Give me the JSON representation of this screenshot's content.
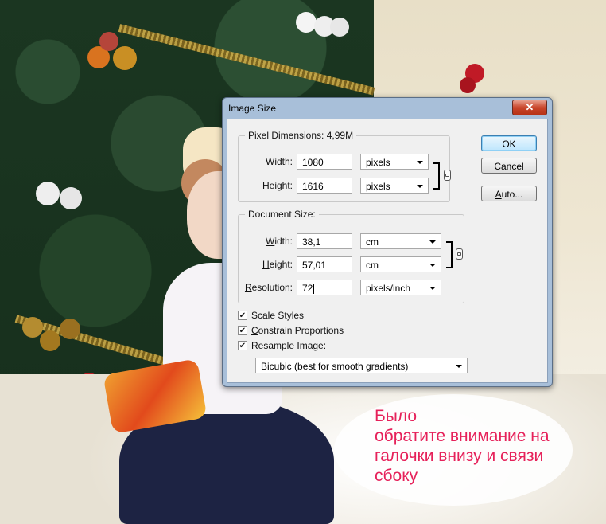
{
  "dialog": {
    "title": "Image Size",
    "close_glyph": "✕",
    "pixel_dimensions": {
      "title": "Pixel Dimensions:",
      "size": "4,99M",
      "width_label_u": "W",
      "width_label_rest": "idth:",
      "width_value": "1080",
      "width_unit": "pixels",
      "height_label_u": "H",
      "height_label_rest": "eight:",
      "height_value": "1616",
      "height_unit": "pixels"
    },
    "document_size": {
      "title": "Document Size:",
      "width_label_u": "W",
      "width_label_rest": "idth:",
      "width_value": "38,1",
      "width_unit": "cm",
      "height_label_u": "H",
      "height_label_rest": "eight:",
      "height_value": "57,01",
      "height_unit": "cm",
      "resolution_label_u": "R",
      "resolution_label_rest": "esolution:",
      "resolution_value": "72",
      "resolution_unit": "pixels/inch"
    },
    "options": {
      "scale_styles": "Scale Styles",
      "constrain_u": "C",
      "constrain_rest": "onstrain Proportions",
      "resample_u": "",
      "resample_rest": "Resample Image:",
      "resample_method": "Bicubic (best for smooth gradients)"
    },
    "buttons": {
      "ok": "OK",
      "cancel": "Cancel",
      "auto_u": "A",
      "auto_rest": "uto..."
    }
  },
  "annotation": {
    "line1": "Было",
    "line2": "обратите внимание на",
    "line3": "галочки внизу и связи",
    "line4": "сбоку",
    "color": "#e6215a"
  }
}
